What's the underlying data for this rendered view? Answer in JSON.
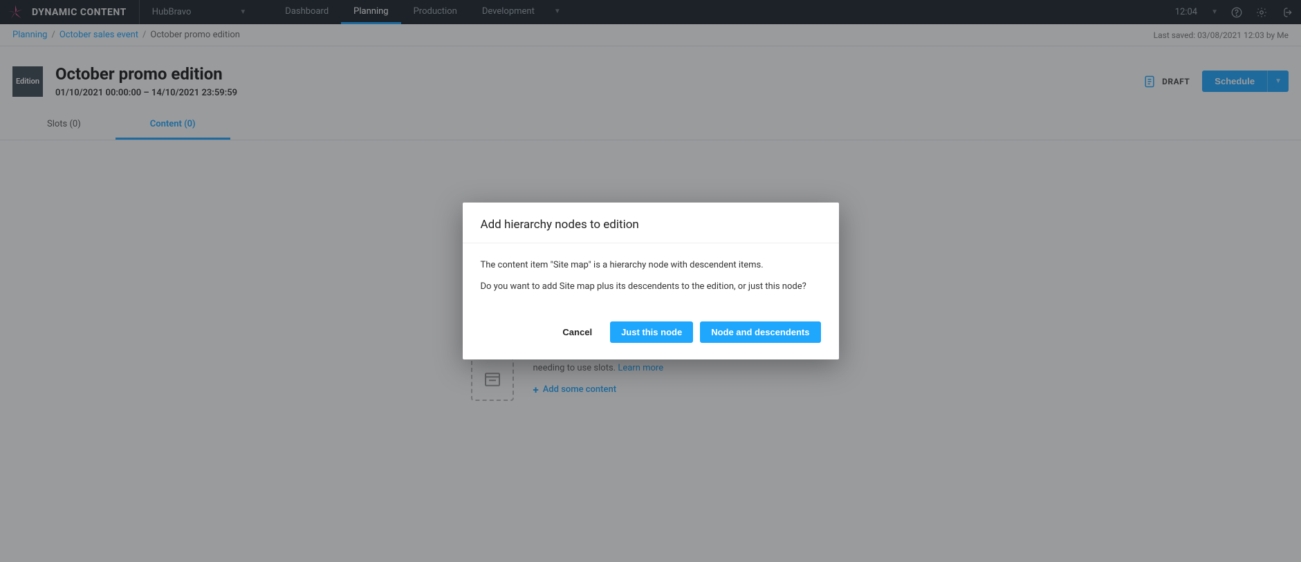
{
  "brand": "DYNAMIC CONTENT",
  "hub": {
    "name": "HubBravo"
  },
  "nav": {
    "items": [
      {
        "label": "Dashboard"
      },
      {
        "label": "Planning"
      },
      {
        "label": "Production"
      },
      {
        "label": "Development"
      }
    ],
    "active": "Planning"
  },
  "clock": "12:04",
  "breadcrumb": {
    "root": "Planning",
    "event": "October sales event",
    "current": "October promo edition"
  },
  "last_saved": "Last saved: 03/08/2021 12:03 by Me",
  "edition": {
    "badge": "Edition",
    "title": "October promo edition",
    "date_range": "01/10/2021 00:00:00  –  14/10/2021 23:59:59",
    "status": "DRAFT",
    "schedule_label": "Schedule"
  },
  "tabs": {
    "slots": "Slots (0)",
    "content": "Content (0)"
  },
  "empty_state": {
    "line": "needing to use slots.",
    "learn_more": "Learn more",
    "add_content": "Add some content"
  },
  "modal": {
    "title": "Add hierarchy nodes to edition",
    "p1": "The content item \"Site map\" is a hierarchy node with descendent items.",
    "p2": "Do you want to add Site map plus its descendents to the edition, or just this node?",
    "cancel": "Cancel",
    "just_node": "Just this node",
    "node_desc": "Node and descendents"
  }
}
